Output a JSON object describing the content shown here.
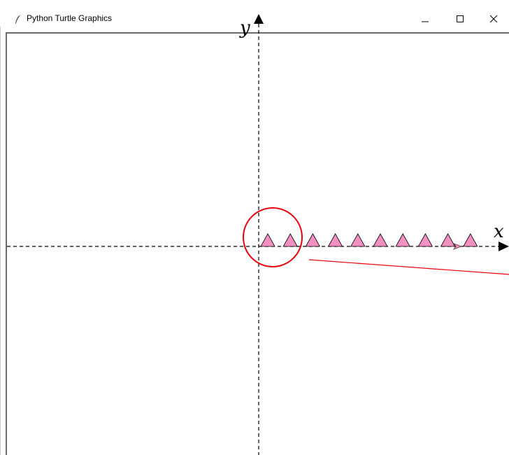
{
  "window": {
    "title": "Python Turtle Graphics",
    "controls": {
      "minimize": "minimize",
      "maximize": "maximize",
      "close": "close"
    }
  },
  "canvas": {
    "x_axis_label": "x",
    "y_axis_label": "y",
    "stamp_color": "#f48fc1",
    "stamp_outline": "#000000",
    "stamp_count": 10,
    "highlight_color": "#e8000b",
    "axis_style": "dashed"
  },
  "icons": [
    "feather-icon",
    "minimize-icon",
    "maximize-icon",
    "close-icon",
    "arrow-up-icon",
    "arrow-right-icon"
  ]
}
